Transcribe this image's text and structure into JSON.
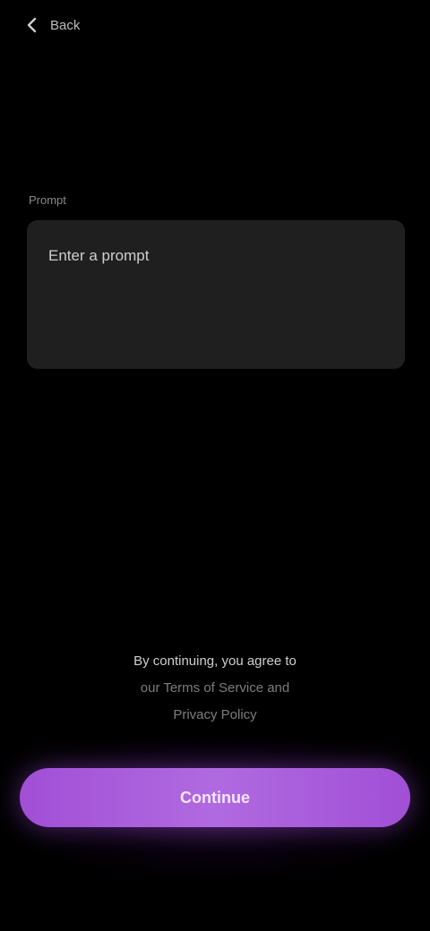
{
  "header": {
    "back_label": "Back",
    "back_icon": "chevron-left-icon"
  },
  "field": {
    "label": "Prompt",
    "placeholder": "Enter a prompt"
  },
  "terms": {
    "line1_lead": "By continuing, you agree to",
    "line2_muted": "our Terms of Service and",
    "line3_muted": "Privacy Policy"
  },
  "cta": {
    "label": "Continue"
  },
  "colors": {
    "background": "#000000",
    "field_bg": "#1f1f1f",
    "accent": "#a14fd6"
  }
}
